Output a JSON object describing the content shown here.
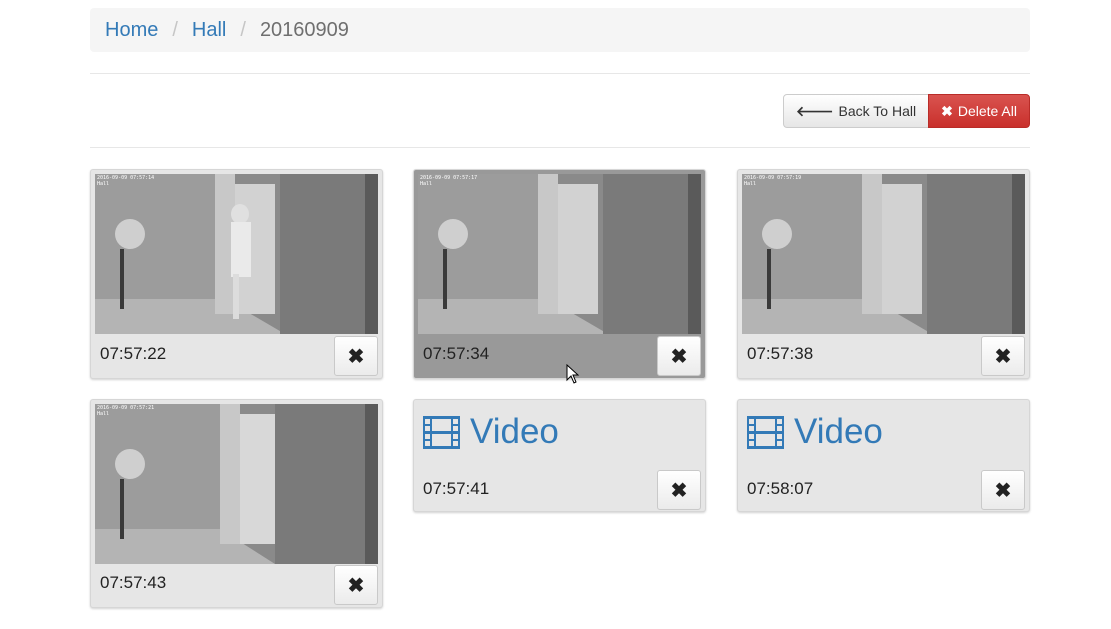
{
  "breadcrumb": {
    "home": "Home",
    "hall": "Hall",
    "current": "20160909"
  },
  "actions": {
    "back_label": "Back To Hall",
    "back_icon": "arrow-left-icon",
    "delete_all_label": "Delete All",
    "delete_all_icon": "times-icon"
  },
  "colors": {
    "link": "#337ab7",
    "danger": "#d9534f",
    "card_bg": "#e6e6e6",
    "card_hover_bg": "#999999"
  },
  "clips": [
    {
      "kind": "image",
      "time": "07:57:22",
      "stamp": "2016-09-09 07:57:14",
      "camera": "Hall"
    },
    {
      "kind": "image",
      "time": "07:57:34",
      "stamp": "2016-09-09 07:57:17",
      "camera": "Hall"
    },
    {
      "kind": "image",
      "time": "07:57:38",
      "stamp": "2016-09-09 07:57:19",
      "camera": "Hall"
    },
    {
      "kind": "image",
      "time": "07:57:43",
      "stamp": "2016-09-09 07:57:21",
      "camera": "Hall"
    },
    {
      "kind": "video",
      "time": "07:57:41",
      "video_label": "Video"
    },
    {
      "kind": "video",
      "time": "07:58:07",
      "video_label": "Video"
    }
  ],
  "delete_icon": "times-icon"
}
